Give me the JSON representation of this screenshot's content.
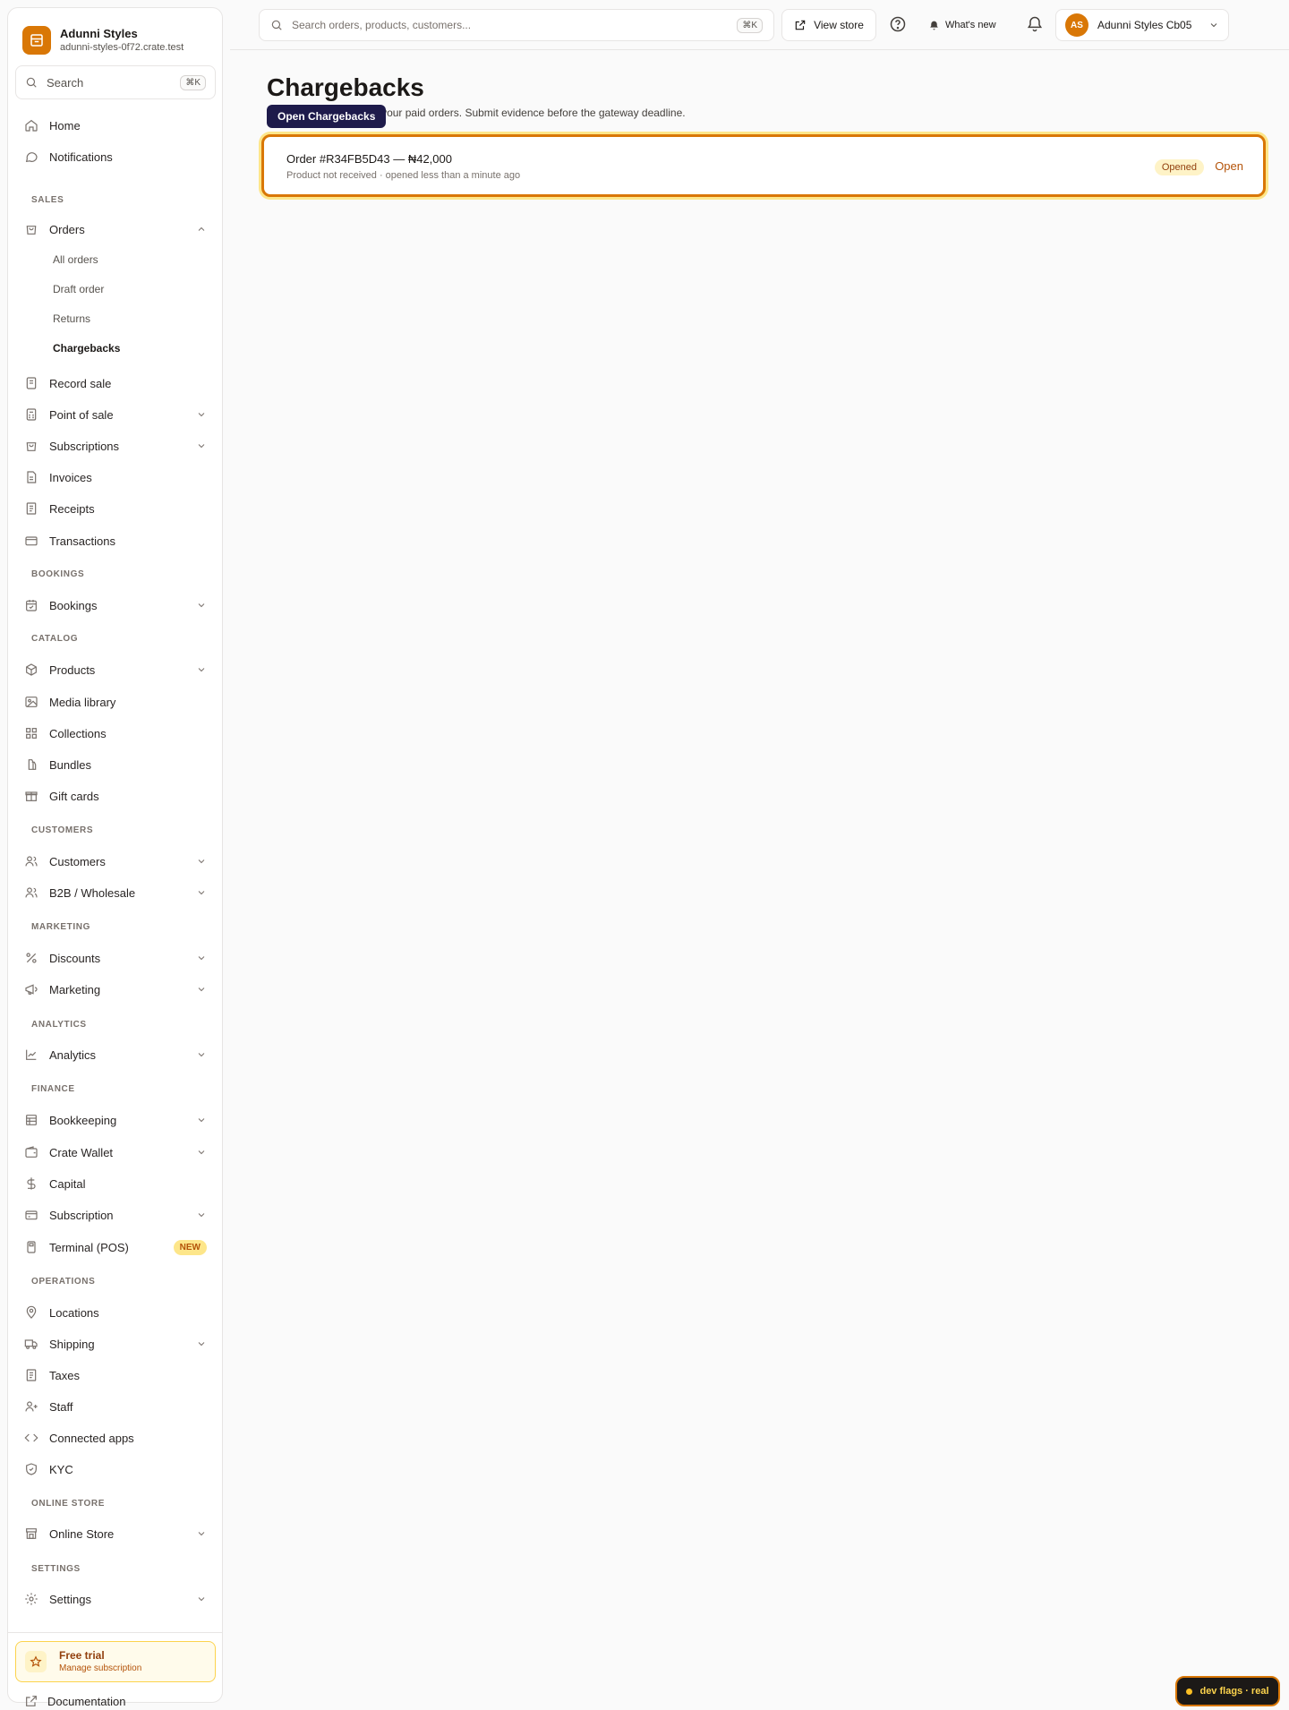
{
  "brand": {
    "name": "Adunni Styles",
    "domain": "adunni-styles-0f72.crate.test"
  },
  "sidebar_search": {
    "label": "Search",
    "shortcut": "⌘K"
  },
  "sections": {
    "sales": "SALES",
    "bookings": "BOOKINGS",
    "catalog": "CATALOG",
    "customers": "CUSTOMERS",
    "marketing": "MARKETING",
    "analytics": "ANALYTICS",
    "finance": "FINANCE",
    "operations": "OPERATIONS",
    "online_store": "ONLINE STORE",
    "settings": "SETTINGS"
  },
  "nav": {
    "home": "Home",
    "notifications": "Notifications",
    "orders": "Orders",
    "orders_sub": {
      "all": "All orders",
      "draft": "Draft order",
      "returns": "Returns",
      "chargebacks": "Chargebacks"
    },
    "record_sale": "Record sale",
    "pos": "Point of sale",
    "subscriptions": "Subscriptions",
    "invoices": "Invoices",
    "receipts": "Receipts",
    "transactions": "Transactions",
    "bookings": "Bookings",
    "products": "Products",
    "media": "Media library",
    "collections": "Collections",
    "bundles": "Bundles",
    "gift_cards": "Gift cards",
    "customers": "Customers",
    "b2b": "B2B / Wholesale",
    "discounts": "Discounts",
    "marketing": "Marketing",
    "analytics": "Analytics",
    "bookkeeping": "Bookkeeping",
    "wallet": "Crate Wallet",
    "capital": "Capital",
    "subscription": "Subscription",
    "terminal": "Terminal (POS)",
    "terminal_badge": "NEW",
    "locations": "Locations",
    "shipping": "Shipping",
    "taxes": "Taxes",
    "staff": "Staff",
    "apps": "Connected apps",
    "kyc": "KYC",
    "online_store": "Online Store",
    "settings": "Settings",
    "documentation": "Documentation"
  },
  "trial": {
    "title": "Free trial",
    "subtitle": "Manage subscription"
  },
  "topbar": {
    "search_placeholder": "Search orders, products, customers...",
    "search_shortcut": "⌘K",
    "view_store": "View store",
    "whats_new": "What's new",
    "account_initials": "AS",
    "account_name": "Adunni Styles Cb05"
  },
  "page": {
    "title": "Chargebacks",
    "subtitle": "Disputes raised against your paid orders. Submit evidence before the gateway deadline.",
    "tooltip": "Open Chargebacks"
  },
  "chargebacks": [
    {
      "title": "Order #R34FB5D43 — ₦42,000",
      "meta": "Product not received · opened less than a minute ago",
      "status": "Opened",
      "action": "Open"
    }
  ],
  "devflags": "dev flags · real",
  "colors": {
    "accent": "#d97706",
    "tooltip": "#1e1b4b"
  }
}
